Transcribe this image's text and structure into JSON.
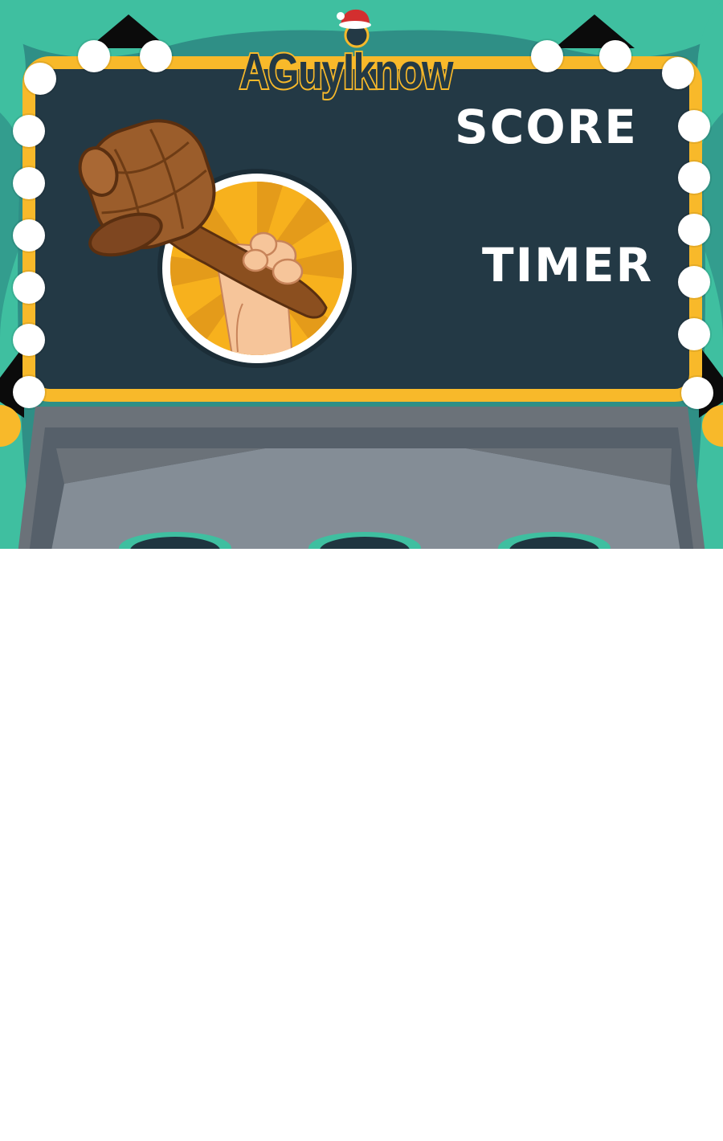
{
  "game": {
    "brand": "AGuyIknow",
    "score_label": "SCORE",
    "timer_label": "TiMER"
  },
  "colors": {
    "curtain": "#3fbfa0",
    "curtain_dark": "#2f8f86",
    "frame": "#f8b92a",
    "board": "#233945",
    "machine": "#848d96",
    "bulb": "#ffffff"
  },
  "icons": {
    "hammer_badge": "hammer-in-fist-icon",
    "hat": "santa-hat-icon"
  }
}
